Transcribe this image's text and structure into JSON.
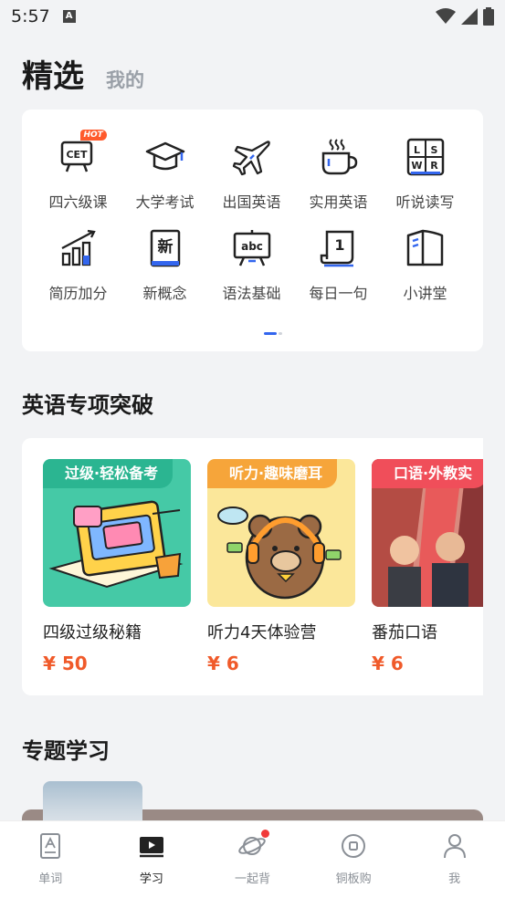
{
  "status_bar": {
    "time": "5:57",
    "notif_icon": "A"
  },
  "header": {
    "tab_active": "精选",
    "tab_inactive": "我的"
  },
  "categories": [
    {
      "label": "四六级课",
      "icon": "cet-icon",
      "badge": "HOT",
      "icon_text": "CET"
    },
    {
      "label": "大学考试",
      "icon": "graduation-cap-icon"
    },
    {
      "label": "出国英语",
      "icon": "airplane-icon"
    },
    {
      "label": "实用英语",
      "icon": "coffee-cup-icon"
    },
    {
      "label": "听说读写",
      "icon": "lswr-icon",
      "icon_letters": [
        "L",
        "S",
        "W",
        "R"
      ]
    },
    {
      "label": "简历加分",
      "icon": "bar-chart-icon"
    },
    {
      "label": "新概念",
      "icon": "new-concept-book-icon",
      "icon_text": "新"
    },
    {
      "label": "语法基础",
      "icon": "abc-board-icon",
      "icon_text": "abc"
    },
    {
      "label": "每日一句",
      "icon": "daily-calendar-icon",
      "icon_text": "1"
    },
    {
      "label": "小讲堂",
      "icon": "open-book-icon"
    }
  ],
  "section_breakthrough": {
    "title": "英语专项突破"
  },
  "courses": [
    {
      "banner": "过级·轻松备考",
      "title": "四级过级秘籍",
      "price": "¥ 50",
      "banner_color": "#2bb591",
      "bg_color": "#45c9a6"
    },
    {
      "banner": "听力·趣味磨耳",
      "title": "听力4天体验营",
      "price": "¥ 6",
      "banner_color": "#f6a53a",
      "bg_color": "#fbe79a"
    },
    {
      "banner": "口语·外教实",
      "title": "番茄口语",
      "price": "¥ 6",
      "banner_color": "#f04e5a",
      "bg_color": "#c0463e"
    }
  ],
  "section_topics": {
    "title": "专题学习"
  },
  "bottom_nav": [
    {
      "label": "单词",
      "icon": "word-card-icon",
      "active": false
    },
    {
      "label": "学习",
      "icon": "study-screen-icon",
      "active": true
    },
    {
      "label": "一起背",
      "icon": "planet-icon",
      "active": false,
      "dot": true
    },
    {
      "label": "铜板购",
      "icon": "coin-icon",
      "active": false
    },
    {
      "label": "我",
      "icon": "person-icon",
      "active": false
    }
  ],
  "colors": {
    "accent": "#3366ee",
    "price": "#f05a2a",
    "hot": "#ff5a2c"
  }
}
